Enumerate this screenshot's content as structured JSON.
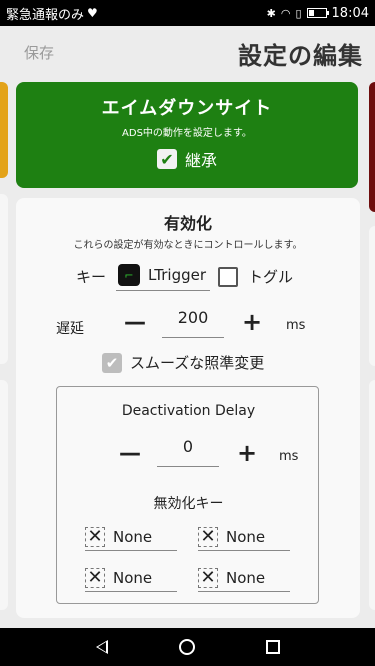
{
  "statusbar": {
    "carrier": "緊急通報のみ",
    "time": "18:04",
    "icons": [
      "heart-icon",
      "bluetooth-icon",
      "wifi-icon",
      "sim-icon",
      "battery-icon"
    ]
  },
  "header": {
    "save_label": "保存",
    "title": "設定の編集"
  },
  "ads_card": {
    "title": "エイムダウンサイト",
    "description": "ADS中の動作を設定します。",
    "inherit_label": "継承",
    "inherit_checked": true,
    "color": "#1e8012"
  },
  "enable_card": {
    "title": "有効化",
    "description": "これらの設定が有効なときにコントロールします。",
    "key_label": "キー",
    "key_value": "LTrigger",
    "toggle_label": "トグル",
    "toggle_checked": false,
    "delay_label": "遅延",
    "delay_value": "200",
    "delay_unit": "ms",
    "smooth_label": "スムーズな照準変更",
    "smooth_checked": true,
    "deactivation": {
      "title": "Deactivation Delay",
      "value": "0",
      "unit": "ms",
      "disable_keys_title": "無効化キー",
      "keys": [
        "None",
        "None",
        "None",
        "None"
      ]
    }
  },
  "nav": {
    "icons": [
      "back-icon",
      "home-icon",
      "recent-apps-icon"
    ]
  }
}
